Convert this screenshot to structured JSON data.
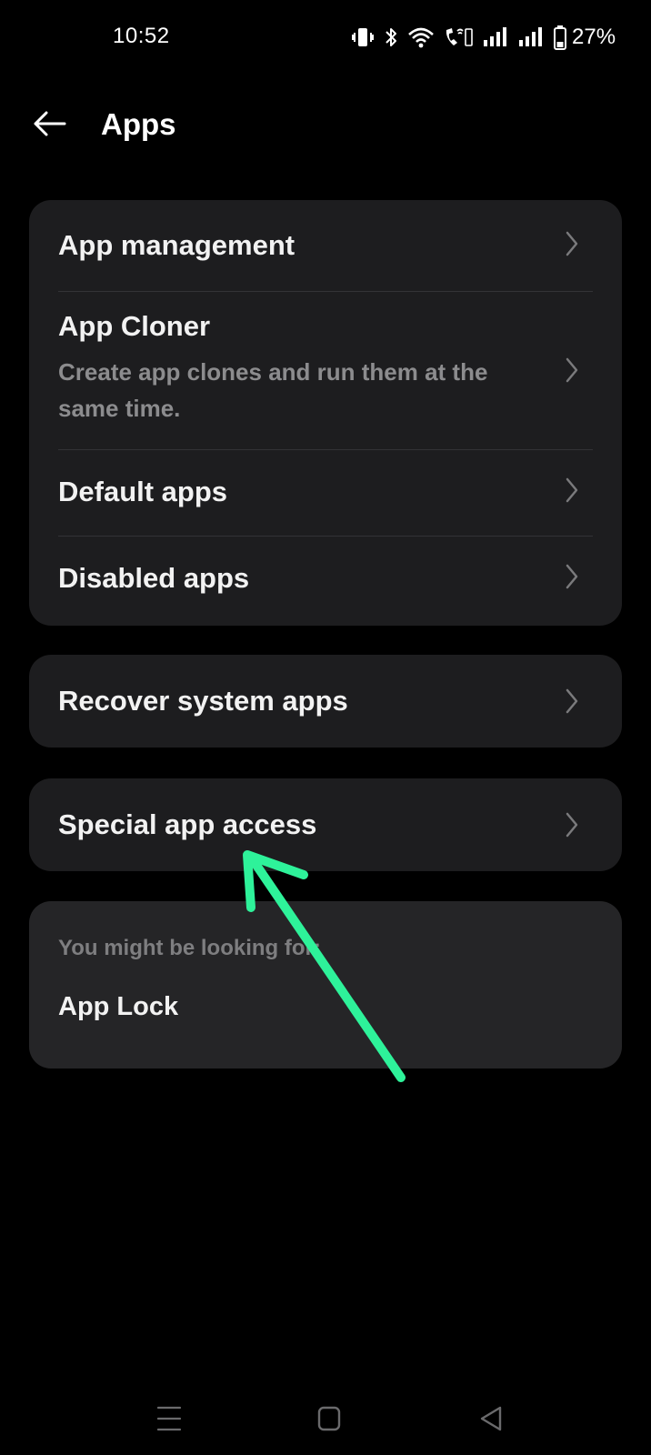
{
  "status_bar": {
    "time": "10:52",
    "battery_percent": "27%",
    "icons": [
      "vibrate-icon",
      "bluetooth-icon",
      "wifi-icon",
      "volte-call-icon",
      "signal-1-icon",
      "signal-2-icon",
      "battery-icon"
    ]
  },
  "header": {
    "back_icon": "back-arrow-icon",
    "title": "Apps"
  },
  "sections": {
    "main": {
      "app_management": "App management",
      "app_cloner": "App Cloner",
      "app_cloner_desc": "Create app clones and run them at the same time.",
      "default_apps": "Default apps",
      "disabled_apps": "Disabled apps"
    },
    "recover": {
      "label": "Recover system apps"
    },
    "special": {
      "label": "Special app access"
    },
    "suggestions": {
      "heading": "You might be looking for:",
      "item": "App Lock"
    }
  },
  "annotation": {
    "arrow_color": "#2ef29a"
  },
  "nav_bar": {
    "icons": [
      "menu-icon",
      "home-icon",
      "back-icon"
    ]
  },
  "colors": {
    "background": "#000000",
    "card": "#1d1d1f",
    "card_suggestions": "#252527",
    "text_primary": "#f2f2f2",
    "text_secondary": "#8c8c8e"
  }
}
